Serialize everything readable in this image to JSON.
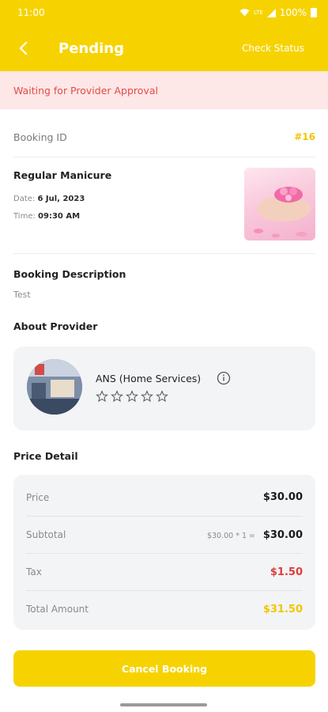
{
  "status_bar": {
    "time": "11:00",
    "network": "LTE",
    "battery": "100%"
  },
  "appbar": {
    "title": "Pending",
    "action": "Check Status"
  },
  "banner": {
    "text": "Waiting for Provider Approval"
  },
  "booking": {
    "id_label": "Booking ID",
    "id_value": "#16",
    "service": "Regular Manicure",
    "date_label": "Date:",
    "date_value": "6 Jul, 2023",
    "time_label": "Time:",
    "time_value": "09:30 AM"
  },
  "description": {
    "title": "Booking Description",
    "text": "Test"
  },
  "provider": {
    "section_title": "About Provider",
    "name": "ANS (Home Services)",
    "rating": 0,
    "max_rating": 5
  },
  "price": {
    "title": "Price Detail",
    "rows": [
      {
        "label": "Price",
        "value": "$30.00"
      },
      {
        "label": "Subtotal",
        "calc": "$30.00 * 1 =",
        "value": "$30.00"
      },
      {
        "label": "Tax",
        "value": "$1.50"
      },
      {
        "label": "Total Amount",
        "value": "$31.50"
      }
    ]
  },
  "actions": {
    "cancel": "Cancel Booking"
  },
  "colors": {
    "accent": "#f6d300",
    "danger": "#e23b3b",
    "banner_bg": "#fde7e7"
  }
}
